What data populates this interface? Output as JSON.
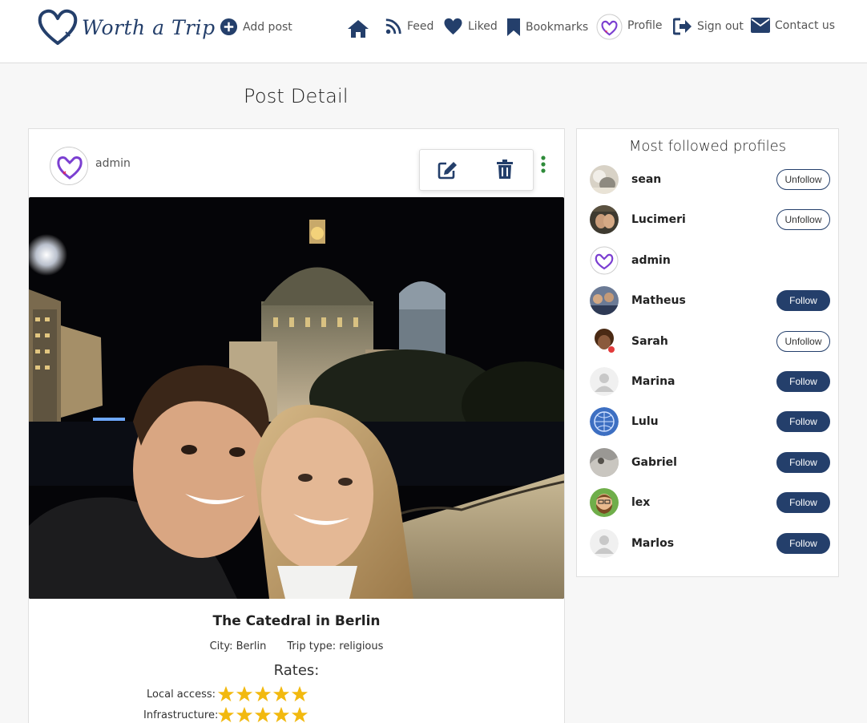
{
  "brand": {
    "name": "Worth a Trip"
  },
  "nav": {
    "add_post": "Add post",
    "feed": "Feed",
    "liked": "Liked",
    "bookmarks": "Bookmarks",
    "profile": "Profile",
    "sign_out": "Sign out",
    "contact_us": "Contact us"
  },
  "page": {
    "title": "Post Detail"
  },
  "post": {
    "author": "admin",
    "title": "The Catedral in Berlin",
    "city": "City: Berlin",
    "trip_type": "Trip type: religious",
    "rates_title": "Rates:",
    "rates": [
      {
        "label": "Local access:",
        "stars": 5
      },
      {
        "label": "Infrastructure:",
        "stars": 5
      }
    ]
  },
  "sidebar": {
    "title": "Most followed profiles",
    "profiles": [
      {
        "name": "sean",
        "action": "Unfollow",
        "avatar": "photo-light"
      },
      {
        "name": "Lucimeri",
        "action": "Unfollow",
        "avatar": "photo-dark"
      },
      {
        "name": "admin",
        "action": "",
        "avatar": "logo"
      },
      {
        "name": "Matheus",
        "action": "Follow",
        "avatar": "photo-crowd"
      },
      {
        "name": "Sarah",
        "action": "Unfollow",
        "avatar": "cartoon-curly"
      },
      {
        "name": "Marina",
        "action": "Follow",
        "avatar": "default"
      },
      {
        "name": "Lulu",
        "action": "Follow",
        "avatar": "globe"
      },
      {
        "name": "Gabriel",
        "action": "Follow",
        "avatar": "photo-grey"
      },
      {
        "name": "lex",
        "action": "Follow",
        "avatar": "cartoon-beard"
      },
      {
        "name": "Marlos",
        "action": "Follow",
        "avatar": "default"
      }
    ]
  },
  "colors": {
    "primary": "#243f6b",
    "star": "#f2b90f",
    "more": "#2e8b3a"
  }
}
